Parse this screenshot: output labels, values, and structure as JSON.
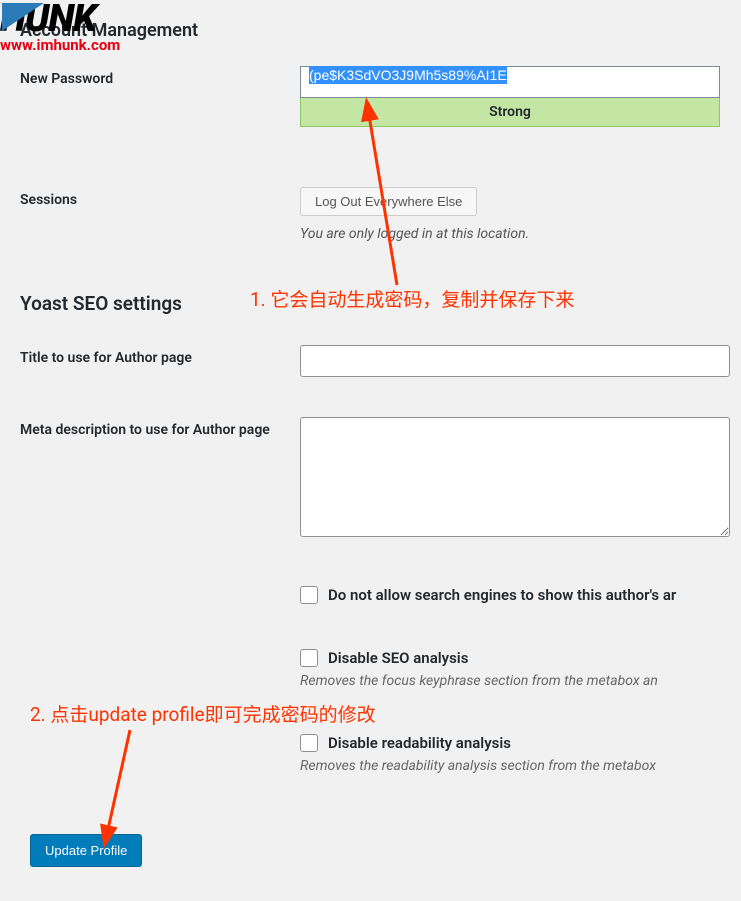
{
  "logo": {
    "text": "HUNK",
    "url": "www.imhunk.com"
  },
  "header": {
    "title": "Account Management"
  },
  "password": {
    "label": "New Password",
    "value": "(pe$K3SdVO3J9Mh5s89%AI1E",
    "strength": "Strong"
  },
  "sessions": {
    "label": "Sessions",
    "button": "Log Out Everywhere Else",
    "help": "You are only logged in at this location."
  },
  "seo": {
    "title": "Yoast SEO settings",
    "author_title_label": "Title to use for Author page",
    "meta_desc_label": "Meta description to use for Author page",
    "checkbox1": "Do not allow search engines to show this author's ar",
    "checkbox2": "Disable SEO analysis",
    "checkbox2_desc": "Removes the focus keyphrase section from the metabox an",
    "checkbox3": "Disable readability analysis",
    "checkbox3_desc": "Removes the readability analysis section from the metabox"
  },
  "submit": {
    "button": "Update Profile"
  },
  "annotations": {
    "note1": "1. 它会自动生成密码，复制并保存下来",
    "note2": "2. 点击update profile即可完成密码的修改"
  }
}
